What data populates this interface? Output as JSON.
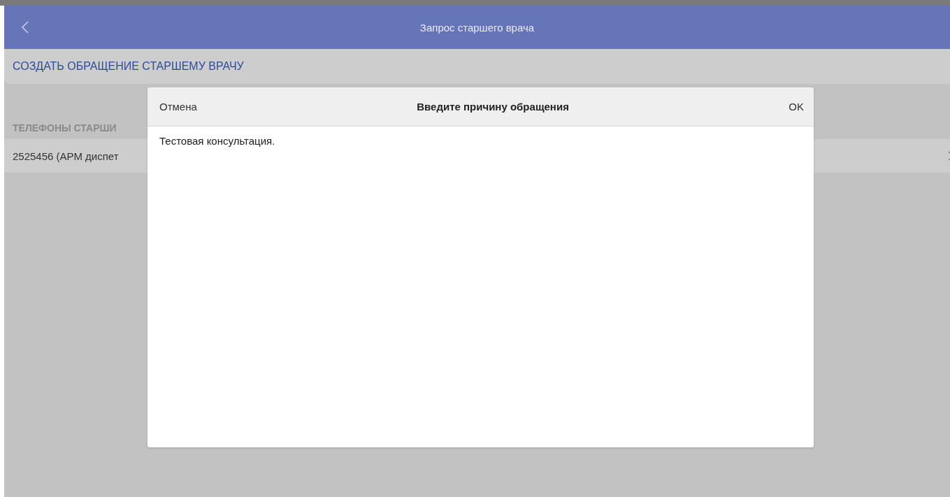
{
  "header": {
    "title": "Запрос старшего врача"
  },
  "action": {
    "label": "СОЗДАТЬ ОБРАЩЕНИЕ СТАРШЕМУ ВРАЧУ"
  },
  "section": {
    "title": "ТЕЛЕФОНЫ СТАРШИ"
  },
  "phones": [
    {
      "label": "2525456 (АРМ диспет"
    }
  ],
  "dialog": {
    "cancel": "Отмена",
    "title": "Введите причину обращения",
    "ok": "OK",
    "value": "Тестовая консультация."
  }
}
